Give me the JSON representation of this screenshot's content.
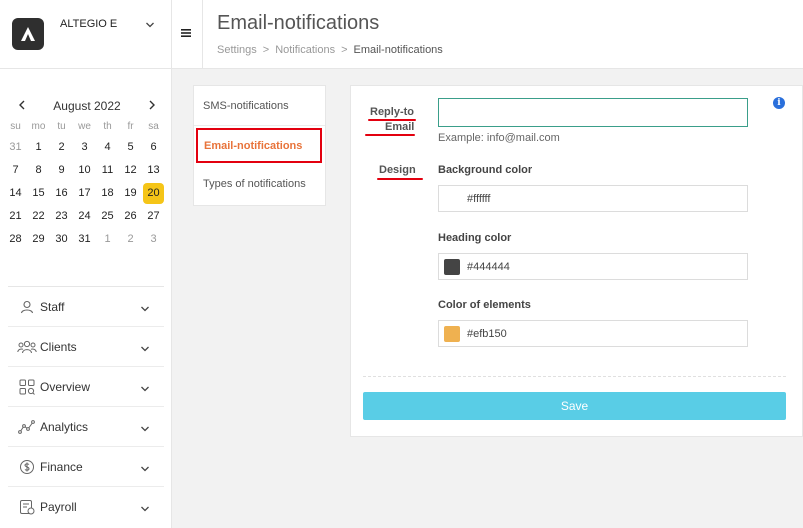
{
  "sidebar": {
    "brand": "ALTEGIO E",
    "calendar": {
      "month": "August 2022",
      "weekdays": [
        "su",
        "mo",
        "tu",
        "we",
        "th",
        "fr",
        "sa"
      ],
      "weeks": [
        [
          "31",
          "1",
          "2",
          "3",
          "4",
          "5",
          "6"
        ],
        [
          "7",
          "8",
          "9",
          "10",
          "11",
          "12",
          "13"
        ],
        [
          "14",
          "15",
          "16",
          "17",
          "18",
          "19",
          "20"
        ],
        [
          "21",
          "22",
          "23",
          "24",
          "25",
          "26",
          "27"
        ],
        [
          "28",
          "29",
          "30",
          "31",
          "1",
          "2",
          "3"
        ]
      ],
      "today": "20"
    },
    "menu": [
      {
        "label": "Staff",
        "icon": "person-icon"
      },
      {
        "label": "Clients",
        "icon": "group-icon"
      },
      {
        "label": "Overview",
        "icon": "overview-grid-icon"
      },
      {
        "label": "Analytics",
        "icon": "analytics-icon"
      },
      {
        "label": "Finance",
        "icon": "dollar-icon"
      },
      {
        "label": "Payroll",
        "icon": "payroll-icon"
      }
    ]
  },
  "header": {
    "title": "Email-notifications",
    "breadcrumb": [
      "Settings",
      "Notifications",
      "Email-notifications"
    ],
    "separator": ">"
  },
  "tabs": [
    {
      "label": "SMS-notifications",
      "active": false
    },
    {
      "label": "Email-notifications",
      "active": true
    },
    {
      "label": "Types of notifications",
      "active": false
    }
  ],
  "form": {
    "reply_to_label_line1": "Reply-to",
    "reply_to_label_line2": "Email",
    "reply_to_value": "",
    "reply_to_hint": "Example: info@mail.com",
    "design_label": "Design",
    "background_color_label": "Background color",
    "background_color_value": "#ffffff",
    "heading_color_label": "Heading color",
    "heading_color_value": "#444444",
    "elements_color_label": "Color of elements",
    "elements_color_value": "#efb150",
    "save_label": "Save",
    "info_glyph": "i"
  },
  "colors": {
    "accent_orange": "#e8733a",
    "annotation_red": "#e3000f",
    "save_button": "#59cde6",
    "today_highlight": "#f5c518",
    "info_blue": "#2a6fdb"
  }
}
